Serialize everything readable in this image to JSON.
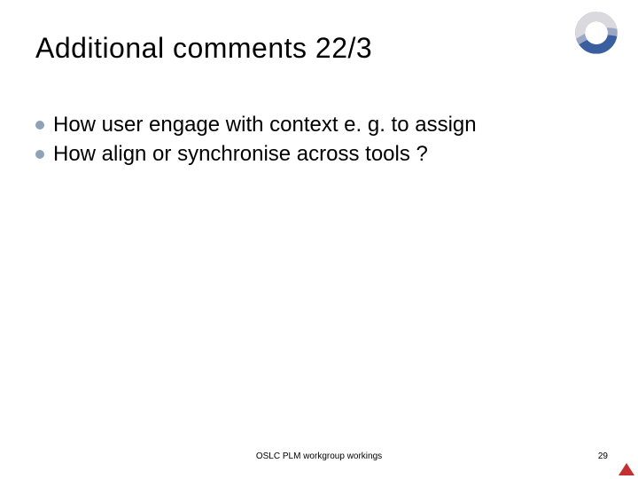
{
  "title": "Additional comments 22/3",
  "bullets": [
    {
      "text": "How user engage with context e. g. to assign"
    },
    {
      "text": "How align or synchronise across tools ?"
    }
  ],
  "footer": {
    "center": "OSLC PLM workgroup workings",
    "page_number": "29"
  },
  "colors": {
    "bullet": "#8ea3b8",
    "triangle": "#c23030"
  }
}
